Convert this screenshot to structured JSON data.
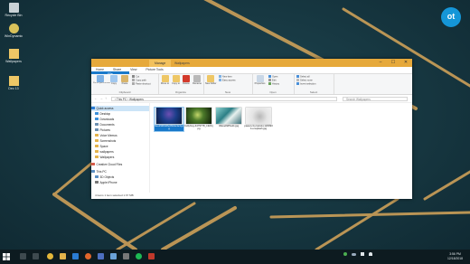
{
  "desktop": {
    "icons": [
      {
        "label": "Recycle Bin",
        "icon": "recycle-bin-icon"
      },
      {
        "label": "WinDynamic",
        "icon": "app-icon"
      },
      {
        "label": "Wallpapers",
        "icon": "folder-icon"
      },
      {
        "label": "Dec 13",
        "icon": "folder-icon"
      }
    ],
    "brand": "ot"
  },
  "window": {
    "context_tab": "Manage",
    "path_label": "Wallpapers",
    "controls": {
      "minimize": "–",
      "maximize": "☐",
      "close": "✕"
    },
    "menu": [
      "File",
      "Home",
      "Share",
      "View",
      "Picture Tools"
    ],
    "ribbon": {
      "groups": [
        "Clipboard",
        "Organize",
        "New",
        "Open",
        "Select"
      ],
      "pin": "Pin to Quick access",
      "copy": "Copy",
      "paste": "Paste",
      "cut": "Cut",
      "copy_path": "Copy path",
      "paste_shortcut": "Paste shortcut",
      "move_to": "Move to",
      "copy_to": "Copy to",
      "delete": "Delete",
      "rename": "Rename",
      "new_folder": "New folder",
      "new_item": "New item",
      "easy_access": "Easy access",
      "properties": "Properties",
      "open": "Open",
      "edit": "Edit",
      "history": "History",
      "select_all": "Select all",
      "select_none": "Select none",
      "invert_selection": "Invert selection"
    },
    "address": "› This PC › Wallpapers",
    "search_placeholder": "Search Wallpapers",
    "nav": [
      {
        "label": "Quick access",
        "color": "#2b7cd3",
        "selected": true
      },
      {
        "label": "Desktop",
        "color": "#3a8fd8",
        "selected": false
      },
      {
        "label": "Downloads",
        "color": "#3a8fd8",
        "selected": false
      },
      {
        "label": "Documents",
        "color": "#6a8fb0",
        "selected": false
      },
      {
        "label": "Pictures",
        "color": "#6a8fb0",
        "selected": false
      },
      {
        "label": "Voice Memos",
        "color": "#e3b34b",
        "selected": false
      },
      {
        "label": "Screenshots",
        "color": "#e3b34b",
        "selected": false
      },
      {
        "label": "Space",
        "color": "#e3b34b",
        "selected": false
      },
      {
        "label": "wallpapers",
        "color": "#e3b34b",
        "selected": false
      },
      {
        "label": "Wallpapers",
        "color": "#e3b34b",
        "selected": false
      },
      {
        "label": "Creative Cloud Files",
        "color": "#d65a4a",
        "selected": false
      },
      {
        "label": "This PC",
        "color": "#5a8ec2",
        "selected": false
      },
      {
        "label": "3D Objects",
        "color": "#5a8ec2",
        "selected": false
      },
      {
        "label": "Apple iPhone",
        "color": "#777777",
        "selected": false
      }
    ],
    "files": [
      {
        "name": "6ee29fd9d8e06b0e3e3.jpg",
        "selected": true,
        "thumb": "thumb-blue"
      },
      {
        "name": "bullyfrog-4479778_1920.jpg",
        "selected": false,
        "thumb": "thumb-green"
      },
      {
        "name": "r0lavel9d5w11.jpg",
        "selected": false,
        "thumb": "thumb-teal"
      },
      {
        "name": "pawel-czerwinski-1209934-unsplash.jpg",
        "selected": false,
        "thumb": "thumb-grey"
      }
    ],
    "status": "4 items    1 item selected  1.67 MB"
  },
  "taskbar": {
    "start": "start-icon",
    "icons": [
      "search-icon",
      "task-view-icon",
      "chrome-icon",
      "file-explorer-icon",
      "mail-icon",
      "firefox-icon",
      "store-icon",
      "photos-icon",
      "settings-icon",
      "spotify-icon",
      "app-icon"
    ],
    "clock_time": "3:56 PM",
    "clock_date": "12/18/2018"
  }
}
